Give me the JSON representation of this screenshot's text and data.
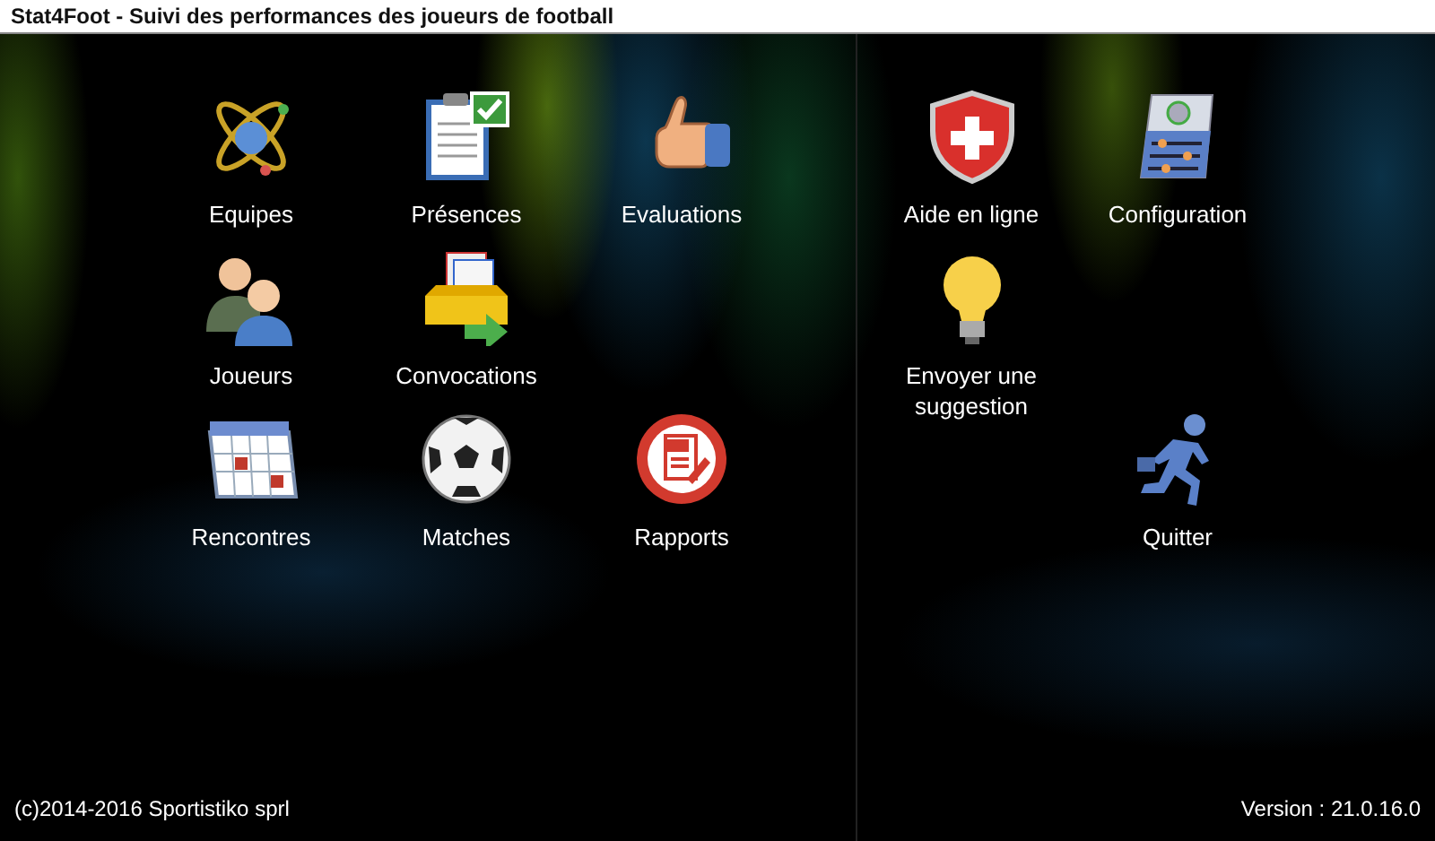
{
  "window": {
    "title": "Stat4Foot - Suivi des performances des joueurs de football"
  },
  "panels": [
    {
      "rows": [
        [
          {
            "kind": "atom",
            "label": "Equipes"
          },
          {
            "kind": "clipboard",
            "label": "Présences"
          },
          {
            "kind": "thumb",
            "label": "Evaluations"
          }
        ],
        [
          {
            "kind": "people",
            "label": "Joueurs"
          },
          {
            "kind": "mailbox",
            "label": "Convocations"
          }
        ],
        [
          {
            "kind": "calendar",
            "label": "Rencontres"
          },
          {
            "kind": "ball",
            "label": "Matches"
          },
          {
            "kind": "pdf",
            "label": "Rapports"
          }
        ]
      ]
    },
    {
      "rows": [
        [
          {
            "kind": "shield",
            "label": "Aide en ligne"
          },
          {
            "kind": "config",
            "label": "Configuration"
          }
        ],
        [
          {
            "kind": "bulb",
            "label": "Envoyer une suggestion"
          }
        ],
        [
          null,
          {
            "kind": "runner",
            "label": "Quitter"
          }
        ]
      ]
    }
  ],
  "footer": {
    "copyright": "(c)2014-2016 Sportistiko sprl",
    "version": "Version : 21.0.16.0"
  }
}
